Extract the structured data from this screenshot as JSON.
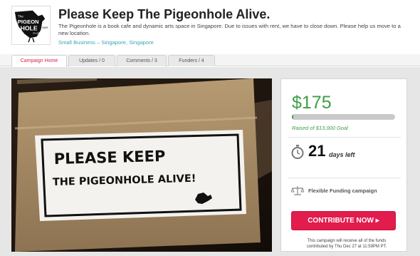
{
  "campaign": {
    "title": "Please Keep The Pigeonhole Alive.",
    "description": "The Pigeonhole is a book cafe and dynamic arts space in Singapore. Due to issues with rent, we have to close down. Please help us move to a new location.",
    "category": "Small Business",
    "separator": "–",
    "location": "Singapore, Singapore"
  },
  "logo": {
    "text_line1": "The",
    "text_line2": "PIGEON",
    "text_line3": "HOLE",
    "text_side": "BAR",
    "text_sub": "GALLERY SPACE"
  },
  "tabs": [
    {
      "label": "Campaign Home",
      "active": true
    },
    {
      "label": "Updates / 0",
      "active": false
    },
    {
      "label": "Comments / 3",
      "active": false
    },
    {
      "label": "Funders / 4",
      "active": false
    }
  ],
  "photo": {
    "sign_line1": "PLEASE KEEP",
    "sign_line2": "THE PIGEONHOLE ALIVE!"
  },
  "funding": {
    "raised": "$175",
    "goal_text": "Raised of $13,000 Goal",
    "progress_fraction": 0.0135,
    "days_left": "21",
    "days_label": "days left",
    "funding_type": "Flexible Funding campaign",
    "contribute_label": "CONTRIBUTE NOW ▸",
    "note": "This campaign will receive all of the funds contributed by Thu Dec 27 at 11:59PM PT."
  },
  "colors": {
    "accent": "#e21c4d",
    "success": "#3f9e44",
    "link": "#3aa4b8"
  }
}
